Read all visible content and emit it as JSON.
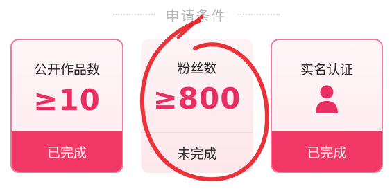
{
  "section_title": "申请条件",
  "cards": [
    {
      "label": "公开作品数",
      "value": "≥10",
      "status": "已完成"
    },
    {
      "label": "粉丝数",
      "value": "≥800",
      "status": "未完成"
    },
    {
      "label": "实名认证",
      "icon": "person-icon",
      "status": "已完成"
    }
  ],
  "colors": {
    "accent": "#e82e62",
    "done_footer": "#f23866",
    "annotation": "#e8282f"
  }
}
